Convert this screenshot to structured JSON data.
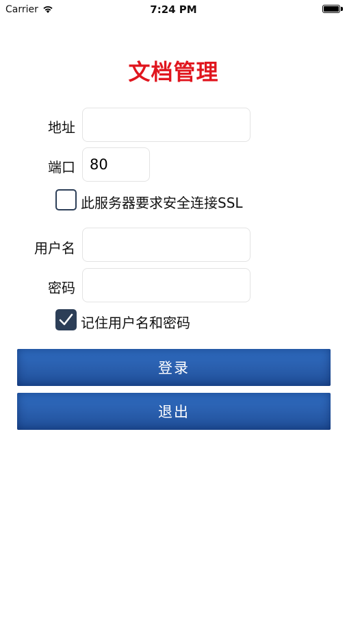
{
  "status_bar": {
    "carrier": "Carrier",
    "time": "7:24 PM"
  },
  "title": "文档管理",
  "server": {
    "address_label": "地址",
    "address_value": "",
    "port_label": "端口",
    "port_value": "80",
    "ssl_label": "此服务器要求安全连接SSL",
    "ssl_checked": false
  },
  "account": {
    "username_label": "用户名",
    "username_value": "",
    "password_label": "密码",
    "password_value": "",
    "remember_label": "记住用户名和密码",
    "remember_checked": true
  },
  "buttons": {
    "login": "登录",
    "exit": "退出"
  },
  "colors": {
    "title": "#e0161e",
    "button": "#2a5fae",
    "checkbox": "#2c3e57"
  },
  "icons": {
    "wifi": "wifi-icon",
    "battery": "battery-icon",
    "check": "checkmark-icon"
  }
}
